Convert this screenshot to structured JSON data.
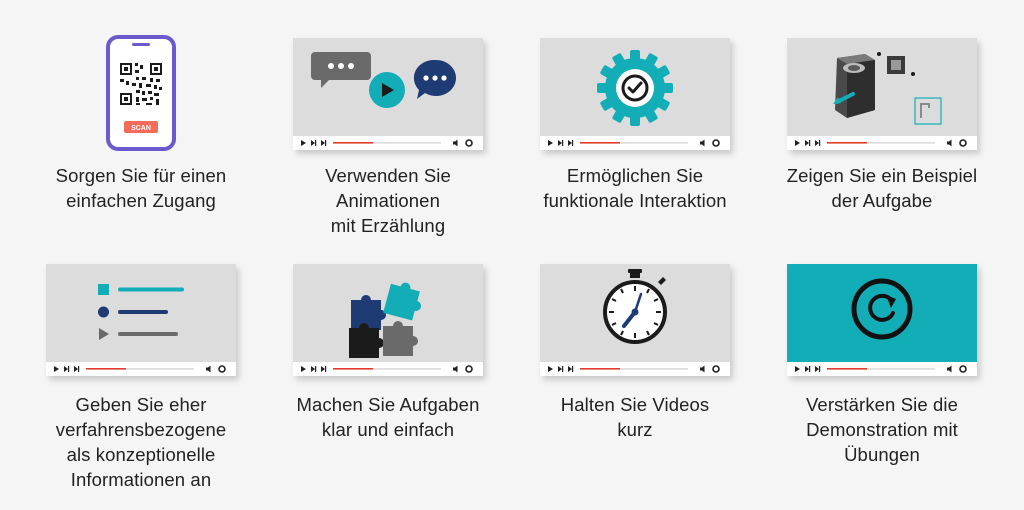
{
  "phone": {
    "button_label": "SCAN"
  },
  "tiles": [
    {
      "caption": "Sorgen Sie für einen\neinfachen Zugang",
      "icon": "qr-phone-icon"
    },
    {
      "caption": "Verwenden Sie\nAnimationen\nmit Erzählung",
      "icon": "speech-bubbles-play-icon"
    },
    {
      "caption": "Ermöglichen Sie\nfunktionale Interaktion",
      "icon": "gear-check-icon"
    },
    {
      "caption": "Zeigen Sie ein Beispiel\nder Aufgabe",
      "icon": "camera-assembly-icon"
    },
    {
      "caption": "Geben Sie eher\nverfahrensbezogene\nals konzeptionelle\nInformationen an",
      "icon": "list-icon"
    },
    {
      "caption": "Machen Sie Aufgaben\nklar und einfach",
      "icon": "puzzle-icon"
    },
    {
      "caption": "Halten Sie Videos\nkurz",
      "icon": "stopwatch-icon"
    },
    {
      "caption": "Verstärken Sie die\nDemonstration mit\nÜbungen",
      "icon": "replay-icon"
    }
  ],
  "colors": {
    "teal": "#12adb7",
    "navy": "#1f3b73",
    "purple": "#6a5acd",
    "progress_red": "#e23b2e",
    "scan_red": "#f26b5b"
  }
}
